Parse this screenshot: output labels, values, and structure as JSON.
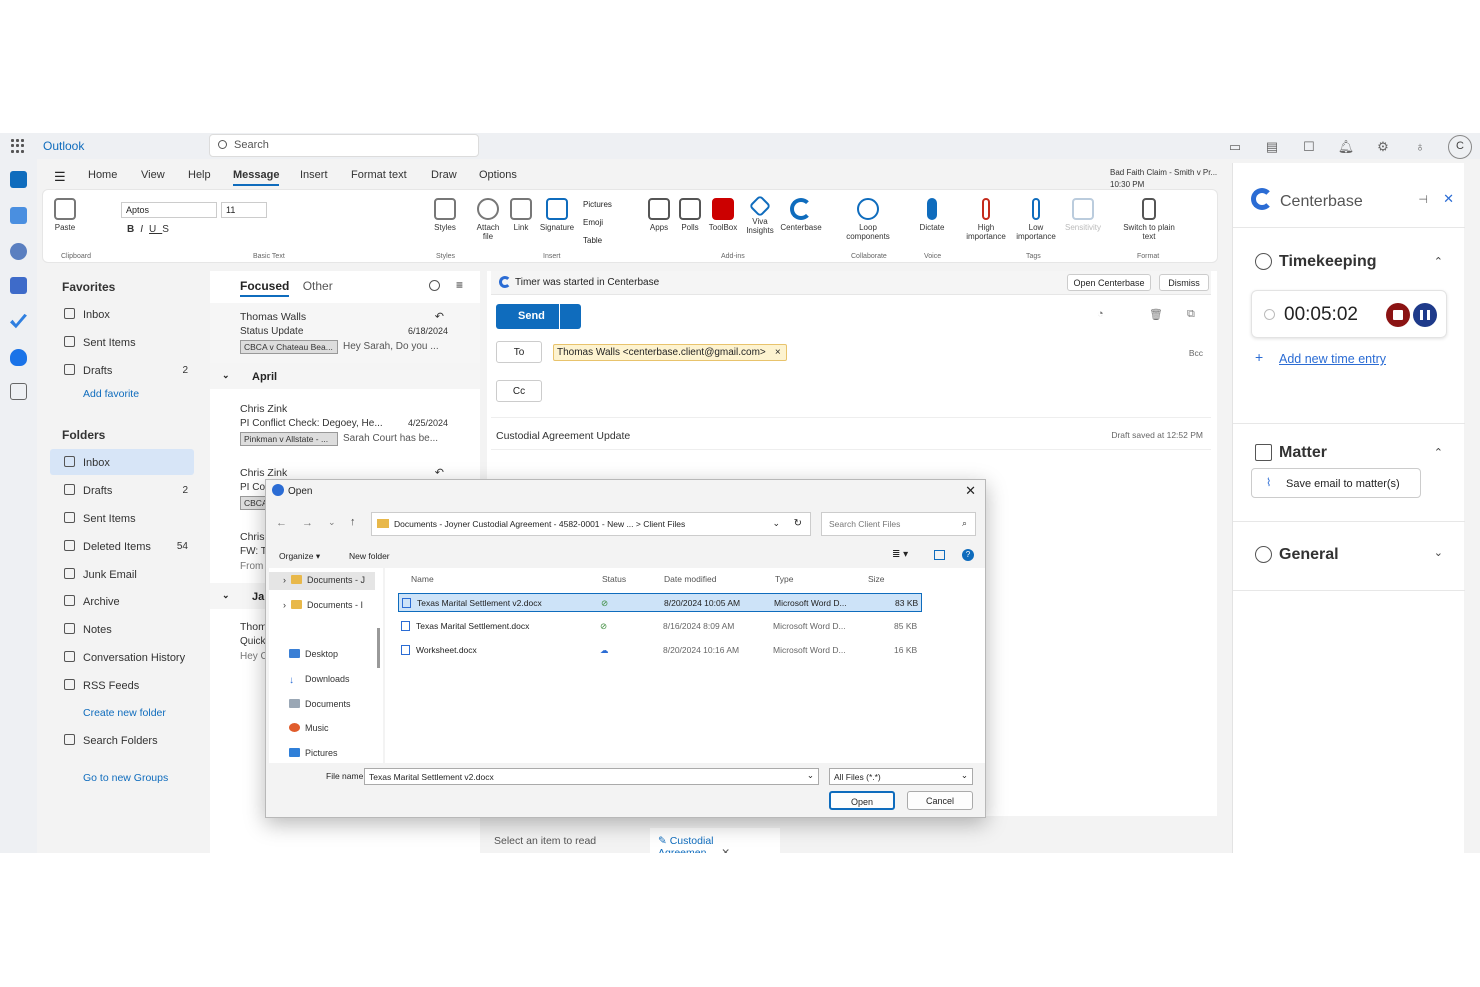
{
  "app": {
    "name": "Outlook",
    "search_placeholder": "Search",
    "avatar": "C"
  },
  "tabs": [
    "Home",
    "View",
    "Help",
    "Message",
    "Insert",
    "Format text",
    "Draw",
    "Options"
  ],
  "ribbon": {
    "font_name": "Aptos",
    "font_size": "11",
    "items": [
      "Paste",
      "Styles",
      "Attach file",
      "Link",
      "Signature",
      "Pictures",
      "Emoji",
      "Table",
      "Apps",
      "Polls",
      "ToolBox",
      "Viva Insights",
      "Centerbase",
      "Loop components",
      "Dictate",
      "High importance",
      "Low importance",
      "Sensitivity",
      "Switch to plain text"
    ],
    "groups": [
      "Clipboard",
      "Basic Text",
      "Styles",
      "Insert",
      "Add-ins",
      "Collaborate",
      "Voice",
      "Tags",
      "Format"
    ]
  },
  "reminder": {
    "title": "Bad Faith Claim - Smith v Pr...",
    "time": "10:30 PM"
  },
  "folders": {
    "favorites_label": "Favorites",
    "favorites": [
      {
        "label": "Inbox",
        "count": ""
      },
      {
        "label": "Sent Items",
        "count": ""
      },
      {
        "label": "Drafts",
        "count": "2"
      }
    ],
    "add_favorite": "Add favorite",
    "folders_label": "Folders",
    "items": [
      {
        "label": "Inbox",
        "count": ""
      },
      {
        "label": "Drafts",
        "count": "2"
      },
      {
        "label": "Sent Items",
        "count": ""
      },
      {
        "label": "Deleted Items",
        "count": "54"
      },
      {
        "label": "Junk Email",
        "count": ""
      },
      {
        "label": "Archive",
        "count": ""
      },
      {
        "label": "Notes",
        "count": ""
      },
      {
        "label": "Conversation History",
        "count": ""
      },
      {
        "label": "RSS Feeds",
        "count": ""
      }
    ],
    "create_new": "Create new folder",
    "search_folders": "Search Folders",
    "groups_link": "Go to new Groups"
  },
  "message_list": {
    "tab_focused": "Focused",
    "tab_other": "Other",
    "messages": [
      {
        "from": "Thomas Walls",
        "subject": "Status Update",
        "date": "6/18/2024",
        "tag": "CBCA v Chateau Bea...",
        "preview": "Hey Sarah, Do you ..."
      },
      {
        "from": "Chris Zink",
        "subject": "PI Conflict Check: Degoey, He...",
        "date": "4/25/2024",
        "tag": "Pinkman v Allstate - ...",
        "preview": "Sarah Court has be..."
      },
      {
        "from": "Chris Zink",
        "subject": "PI Co",
        "date": "",
        "tag": "CBCA",
        "preview": ""
      },
      {
        "from": "Chris",
        "subject": "FW: T",
        "date": "",
        "tag": "",
        "preview": "From"
      },
      {
        "from": "Thom",
        "subject": "Quick",
        "date": "",
        "tag": "",
        "preview": "Hey C"
      }
    ],
    "groups": [
      "April",
      "Janua"
    ]
  },
  "compose": {
    "banner": "Timer was started in Centerbase",
    "open_centerbase": "Open Centerbase",
    "dismiss": "Dismiss",
    "send": "Send",
    "to_label": "To",
    "cc_label": "Cc",
    "bcc_label": "Bcc",
    "recipient": "Thomas Walls <centerbase.client@gmail.com>",
    "subject": "Custodial Agreement Update",
    "draft_saved": "Draft saved at 12:52 PM"
  },
  "bottom_tabs": {
    "read": "Select an item to read",
    "draft": "Custodial Agreemen..."
  },
  "centerbase": {
    "title": "Centerbase",
    "timekeeping": "Timekeeping",
    "timer": "00:05:02",
    "add_time": "Add new time entry",
    "matter": "Matter",
    "save_email": "Save email to matter(s)",
    "general": "General"
  },
  "dialog": {
    "title": "Open",
    "path": "Documents - Joyner Custodial Agreement - 4582-0001 - New ...  >  Client Files",
    "search_placeholder": "Search Client Files",
    "organize": "Organize",
    "new_folder": "New folder",
    "nav": [
      "Documents - J",
      "Documents - I",
      "Desktop",
      "Downloads",
      "Documents",
      "Music",
      "Pictures"
    ],
    "columns": [
      "Name",
      "Status",
      "Date modified",
      "Type",
      "Size"
    ],
    "files": [
      {
        "name": "Texas Marital Settlement v2.docx",
        "status": "synced",
        "date": "8/20/2024 10:05 AM",
        "type": "Microsoft Word D...",
        "size": "83 KB"
      },
      {
        "name": "Texas Marital Settlement.docx",
        "status": "synced",
        "date": "8/16/2024 8:09 AM",
        "type": "Microsoft Word D...",
        "size": "85 KB"
      },
      {
        "name": "Worksheet.docx",
        "status": "cloud",
        "date": "8/20/2024 10:16 AM",
        "type": "Microsoft Word D...",
        "size": "16 KB"
      }
    ],
    "file_name_label": "File name:",
    "file_name": "Texas Marital Settlement v2.docx",
    "file_type": "All Files (*.*)",
    "open": "Open",
    "cancel": "Cancel"
  },
  "colors": {
    "accent": "#0f6cbd",
    "selected": "#d7e5f7",
    "stop": "#8b1313",
    "pause": "#1e3a8a"
  }
}
